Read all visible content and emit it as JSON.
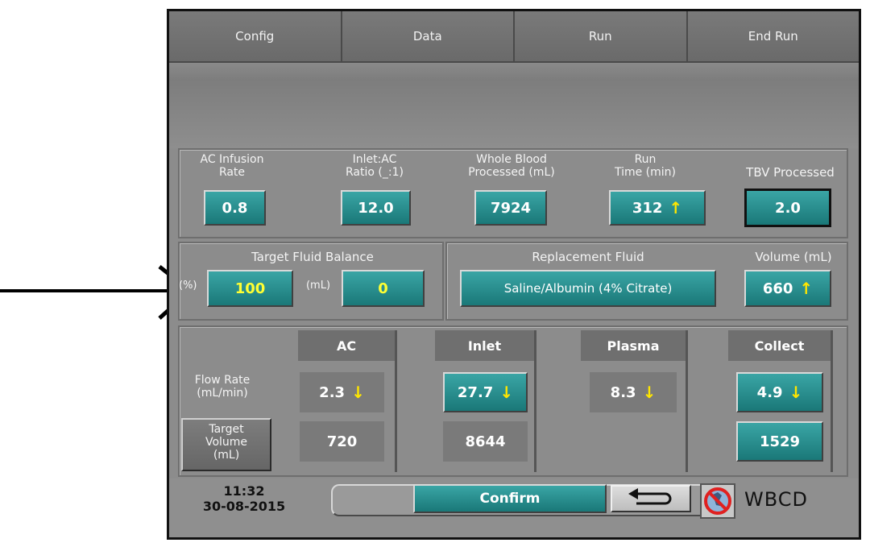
{
  "tabs": [
    "Config",
    "Data",
    "Run",
    "End Run"
  ],
  "metrics": [
    {
      "label_line1": "AC Infusion",
      "label_line2": "Rate",
      "value": "0.8",
      "arrow": ""
    },
    {
      "label_line1": "Inlet:AC",
      "label_line2": "Ratio (_:1)",
      "value": "12.0",
      "arrow": ""
    },
    {
      "label_line1": "Whole Blood",
      "label_line2": "Processed (mL)",
      "value": "7924",
      "arrow": ""
    },
    {
      "label_line1": "Run",
      "label_line2": "Time (min)",
      "value": "312",
      "arrow": "up"
    },
    {
      "label_line1": "",
      "label_line2": "TBV Processed",
      "value": "2.0",
      "arrow": ""
    }
  ],
  "fluid_balance": {
    "title": "Target Fluid Balance",
    "percent_unit": "(%)",
    "percent_value": "100",
    "ml_unit": "(mL)",
    "ml_value": "0"
  },
  "replacement": {
    "title": "Replacement Fluid",
    "fluid": "Saline/Albumin (4% Citrate)",
    "volume_label": "Volume (mL)",
    "volume_value": "660",
    "volume_arrow": "up"
  },
  "flow": {
    "row_label_line1": "Flow Rate",
    "row_label_line2": "(mL/min)",
    "target_label_line1": "Target",
    "target_label_line2": "Volume",
    "target_label_line3": "(mL)",
    "columns": [
      {
        "name": "AC",
        "rate": "2.3",
        "rate_arrow": "down",
        "target": "720"
      },
      {
        "name": "Inlet",
        "rate": "27.7",
        "rate_arrow": "down",
        "target": "8644"
      },
      {
        "name": "Plasma",
        "rate": "8.3",
        "rate_arrow": "down",
        "target": ""
      },
      {
        "name": "Collect",
        "rate": "4.9",
        "rate_arrow": "down",
        "target": "1529"
      }
    ]
  },
  "footer": {
    "time": "11:32",
    "date": "30-08-2015",
    "confirm_label": "Confirm",
    "mode": "WBCD"
  },
  "icons": {
    "up": "↑",
    "down": "↓",
    "back": "back-arrow-icon",
    "no_person": "no-person-icon",
    "pointer": "pointer-arrow-icon"
  },
  "colors": {
    "button_teal": "#1f8585",
    "yellow_text": "#ffff33",
    "arrow_yellow": "#ffe600",
    "background_grey": "#8c8c8c"
  }
}
